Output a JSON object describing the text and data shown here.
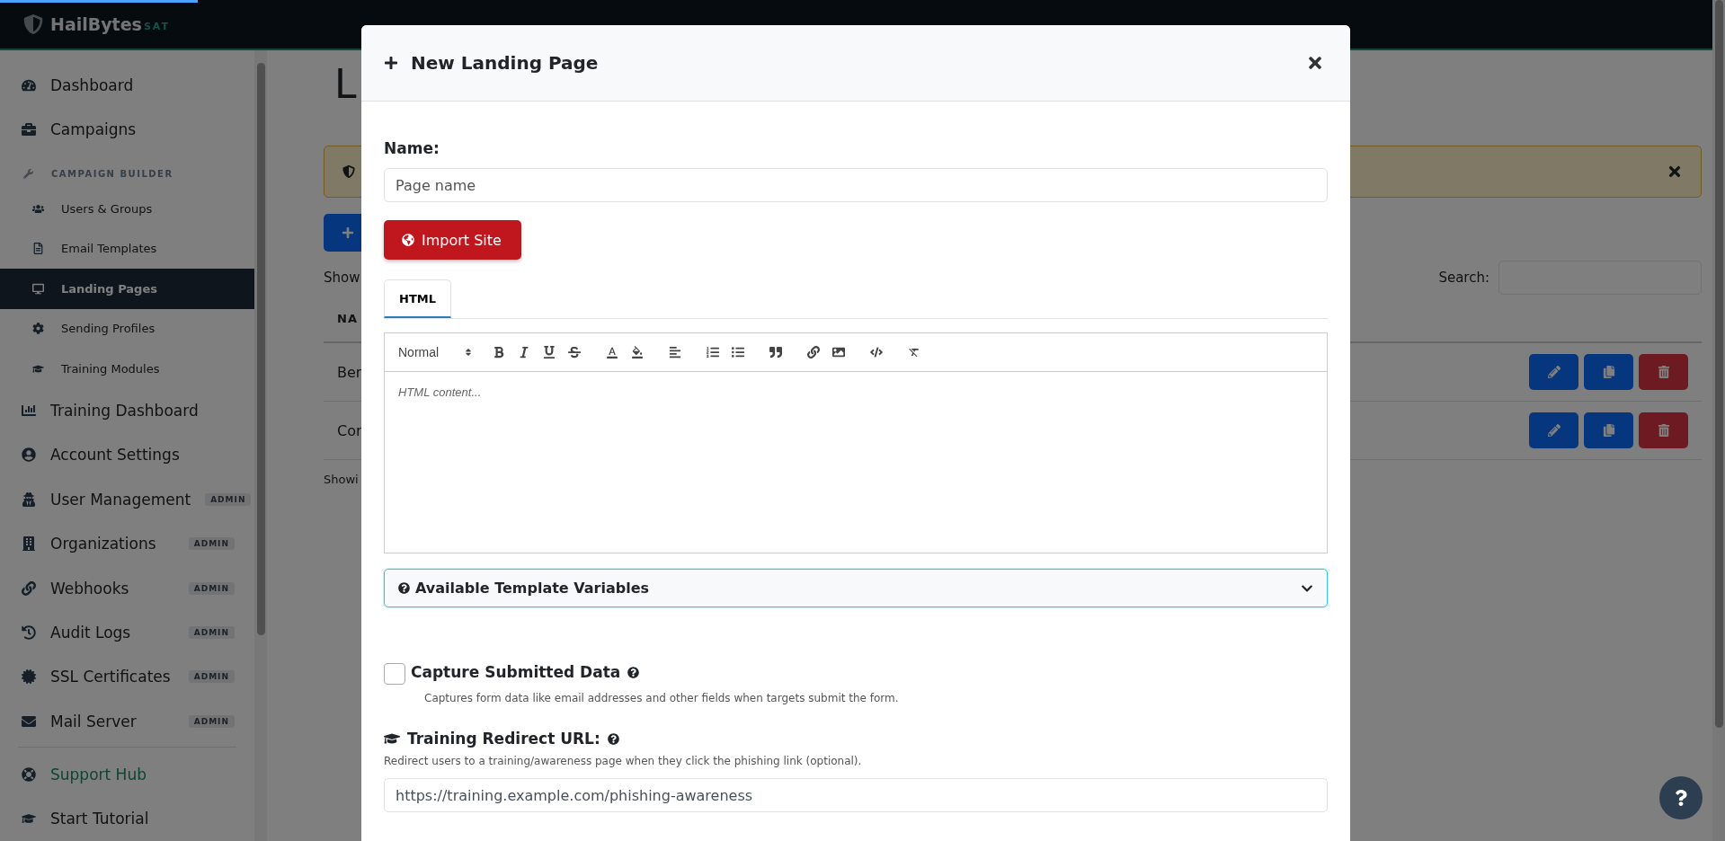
{
  "brand": {
    "name": "HailBytes",
    "suffix": "SAT"
  },
  "sidebar": {
    "items": [
      {
        "kind": "top",
        "label": "Dashboard",
        "selected": false
      },
      {
        "kind": "top",
        "label": "Campaigns",
        "selected": false
      },
      {
        "kind": "section",
        "label": "CAMPAIGN BUILDER",
        "children": [
          {
            "kind": "sub",
            "label": "Users & Groups",
            "selected": false
          },
          {
            "kind": "sub",
            "label": "Email Templates",
            "selected": false
          },
          {
            "kind": "sub",
            "label": "Landing Pages",
            "selected": true
          },
          {
            "kind": "sub",
            "label": "Sending Profiles",
            "selected": false
          },
          {
            "kind": "sub",
            "label": "Training Modules",
            "selected": false
          }
        ]
      },
      {
        "kind": "top",
        "label": "Training Dashboard",
        "selected": false
      },
      {
        "kind": "top",
        "label": "Account Settings",
        "selected": false
      },
      {
        "kind": "top",
        "label": "User Management",
        "badge": "ADMIN",
        "selected": false
      },
      {
        "kind": "top",
        "label": "Organizations",
        "badge": "ADMIN",
        "selected": false
      },
      {
        "kind": "top",
        "label": "Webhooks",
        "badge": "ADMIN",
        "selected": false
      },
      {
        "kind": "top",
        "label": "Audit Logs",
        "badge": "ADMIN",
        "selected": false
      },
      {
        "kind": "top",
        "label": "SSL Certificates",
        "badge": "ADMIN",
        "selected": false
      },
      {
        "kind": "top",
        "label": "Mail Server",
        "badge": "ADMIN",
        "selected": false
      },
      {
        "kind": "divider"
      },
      {
        "kind": "support",
        "label": "Support Hub",
        "selected": false
      },
      {
        "kind": "top",
        "label": "Start Tutorial",
        "selected": false
      }
    ]
  },
  "page": {
    "title": "L",
    "show_text": "Show",
    "table": {
      "column": "NA",
      "rows": [
        {
          "name": "Ber"
        },
        {
          "name": "Cor"
        }
      ]
    },
    "footer_text": "Showi",
    "search_label": "Search:"
  },
  "modal": {
    "title": "New Landing Page",
    "name_label": "Name:",
    "name_placeholder": "Page name",
    "import_button": "Import Site",
    "tabs": [
      {
        "label": "HTML",
        "selected": true
      }
    ],
    "editor": {
      "format": "Normal",
      "placeholder": "HTML content..."
    },
    "accordion": {
      "label": "Available Template Variables",
      "expanded": false
    },
    "capture": {
      "label": "Capture Submitted Data",
      "checked": false,
      "help": "Captures form data like email addresses and other fields when targets submit the form."
    },
    "redirect": {
      "label": "Training Redirect URL:",
      "description": "Redirect users to a training/awareness page when they click the phishing link (optional).",
      "value": "https://training.example.com/phishing-awareness"
    }
  }
}
